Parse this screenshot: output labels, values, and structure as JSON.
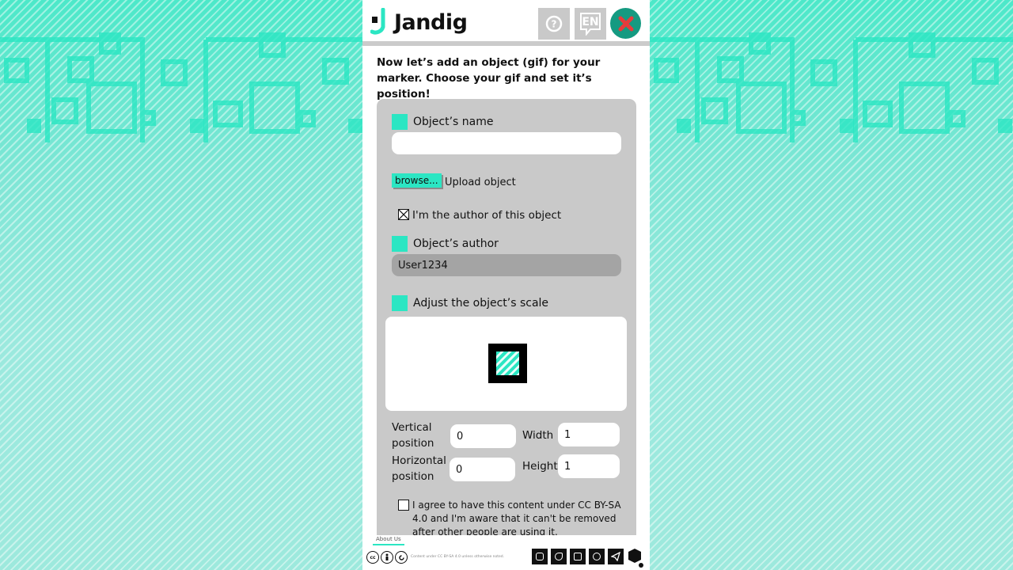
{
  "app": {
    "logo_text": "Jandig"
  },
  "header": {
    "help_icon": "question-icon",
    "lang_label": "EN",
    "close_icon": "close-x-icon"
  },
  "intro": {
    "text": "Now let’s add an object (gif) for your marker. Choose your gif and set it’s position!"
  },
  "form": {
    "name_label": "Object’s name",
    "name_value": "",
    "browse_label": "browse...",
    "upload_label": "Upload object",
    "author_checkbox_label": "I'm the author of this object",
    "author_checkbox_checked": true,
    "author_label": "Object’s author",
    "author_value": "User1234",
    "scale_label": "Adjust the object’s scale",
    "vertical_label": "Vertical position",
    "vertical_value": "0",
    "horizontal_label": "Horizontal position",
    "horizontal_value": "0",
    "width_label": "Width",
    "width_value": "1",
    "height_label": "Height",
    "height_value": "1",
    "agree_text": "I agree to have this content under CC BY-SA 4.0 and I'm aware that it can't be removed after other people are using it.",
    "agree_checked": false
  },
  "footer": {
    "about_label": "About Us",
    "license_text": "Content under CC BY-SA 4.0 unless otherwise noted.",
    "social_icons": [
      "instagram-icon",
      "twitter-icon",
      "facebook-icon",
      "github-icon",
      "telegram-icon"
    ]
  },
  "colors": {
    "accent": "#2be6c3",
    "close": "#159a81",
    "card": "#c9c9c9",
    "close_x": "#e63c3c"
  }
}
